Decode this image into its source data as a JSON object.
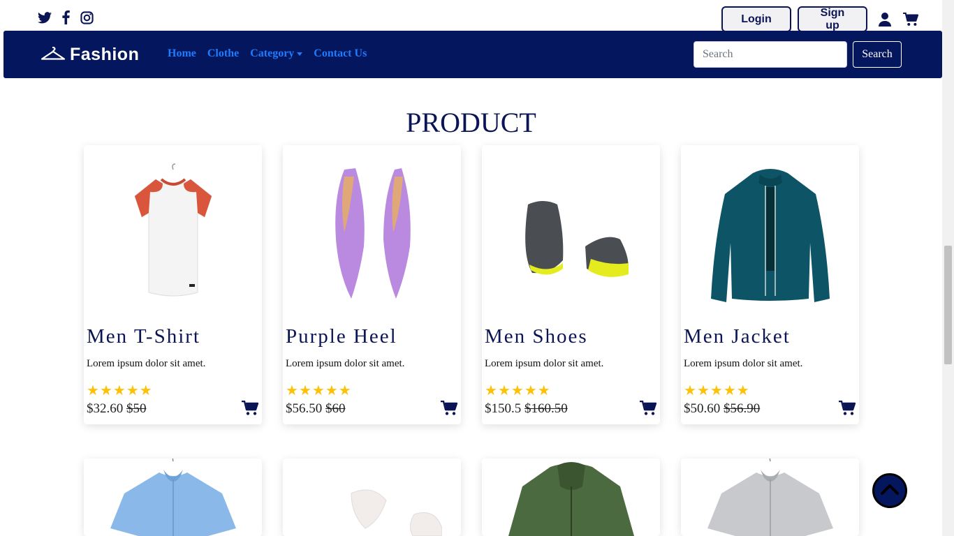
{
  "social": {
    "twitter": "twitter-icon",
    "facebook": "facebook-icon",
    "instagram": "instagram-icon"
  },
  "auth": {
    "login": "Login",
    "signup": "Sign up",
    "user_icon": "user-icon",
    "cart_icon": "cart-icon"
  },
  "navbar": {
    "brand": "Fashion",
    "links": [
      "Home",
      "Clothe",
      "Category",
      "Contact Us"
    ],
    "search_placeholder": "Search",
    "search_button": "Search"
  },
  "section_title": "PRODUCT",
  "products": [
    {
      "name": "Men T-Shirt",
      "desc": "Lorem ipsum dolor sit amet.",
      "price": "$32.60",
      "old_price": "$50",
      "rating": 5
    },
    {
      "name": "Purple Heel",
      "desc": "Lorem ipsum dolor sit amet.",
      "price": "$56.50",
      "old_price": "$60",
      "rating": 5
    },
    {
      "name": "Men Shoes",
      "desc": "Lorem ipsum dolor sit amet.",
      "price": "$150.5",
      "old_price": "$160.50",
      "rating": 5
    },
    {
      "name": "Men Jacket",
      "desc": "Lorem ipsum dolor sit amet.",
      "price": "$50.60",
      "old_price": "$56.90",
      "rating": 5
    }
  ],
  "colors": {
    "navy": "#04165d",
    "link": "#1f7bff",
    "star": "#ffc107"
  }
}
